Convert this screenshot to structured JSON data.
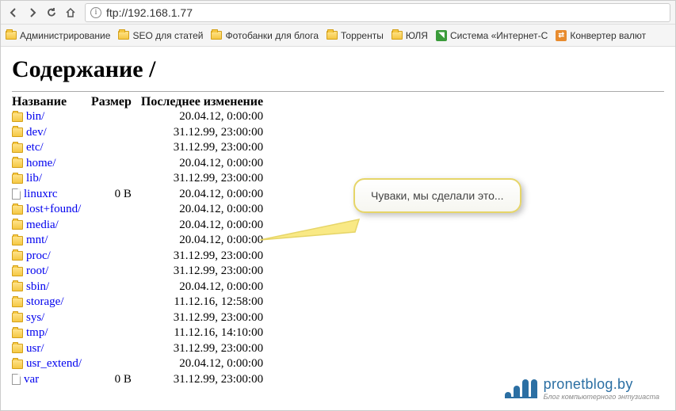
{
  "toolbar": {
    "url": "ftp://192.168.1.77"
  },
  "bookmarks": [
    {
      "icon": "folder",
      "label": "Администрирование"
    },
    {
      "icon": "folder",
      "label": "SEO для статей"
    },
    {
      "icon": "folder",
      "label": "Фотобанки для блога"
    },
    {
      "icon": "folder",
      "label": "Торренты"
    },
    {
      "icon": "folder",
      "label": "ЮЛЯ"
    },
    {
      "icon": "green",
      "label": "Система «Интернет-С"
    },
    {
      "icon": "orange",
      "label": "Конвертер валют"
    }
  ],
  "page": {
    "title": "Содержание /",
    "headers": {
      "name": "Название",
      "size": "Размер",
      "modified": "Последнее изменение"
    }
  },
  "files": [
    {
      "type": "folder",
      "name": "bin/",
      "size": "",
      "date": "20.04.12, 0:00:00"
    },
    {
      "type": "folder",
      "name": "dev/",
      "size": "",
      "date": "31.12.99, 23:00:00"
    },
    {
      "type": "folder",
      "name": "etc/",
      "size": "",
      "date": "31.12.99, 23:00:00"
    },
    {
      "type": "folder",
      "name": "home/",
      "size": "",
      "date": "20.04.12, 0:00:00"
    },
    {
      "type": "folder",
      "name": "lib/",
      "size": "",
      "date": "31.12.99, 23:00:00"
    },
    {
      "type": "file",
      "name": "linuxrc",
      "size": "0 B",
      "date": "20.04.12, 0:00:00"
    },
    {
      "type": "folder",
      "name": "lost+found/",
      "size": "",
      "date": "20.04.12, 0:00:00"
    },
    {
      "type": "folder",
      "name": "media/",
      "size": "",
      "date": "20.04.12, 0:00:00"
    },
    {
      "type": "folder",
      "name": "mnt/",
      "size": "",
      "date": "20.04.12, 0:00:00"
    },
    {
      "type": "folder",
      "name": "proc/",
      "size": "",
      "date": "31.12.99, 23:00:00"
    },
    {
      "type": "folder",
      "name": "root/",
      "size": "",
      "date": "31.12.99, 23:00:00"
    },
    {
      "type": "folder",
      "name": "sbin/",
      "size": "",
      "date": "20.04.12, 0:00:00"
    },
    {
      "type": "folder",
      "name": "storage/",
      "size": "",
      "date": "11.12.16, 12:58:00"
    },
    {
      "type": "folder",
      "name": "sys/",
      "size": "",
      "date": "31.12.99, 23:00:00"
    },
    {
      "type": "folder",
      "name": "tmp/",
      "size": "",
      "date": "11.12.16, 14:10:00"
    },
    {
      "type": "folder",
      "name": "usr/",
      "size": "",
      "date": "31.12.99, 23:00:00"
    },
    {
      "type": "folder",
      "name": "usr_extend/",
      "size": "",
      "date": "20.04.12, 0:00:00"
    },
    {
      "type": "file",
      "name": "var",
      "size": "0 B",
      "date": "31.12.99, 23:00:00"
    }
  ],
  "callout": {
    "text": "Чуваки, мы сделали это..."
  },
  "logo": {
    "main": "pronetblog.by",
    "sub": "Блог компьютерного энтузиаста"
  }
}
